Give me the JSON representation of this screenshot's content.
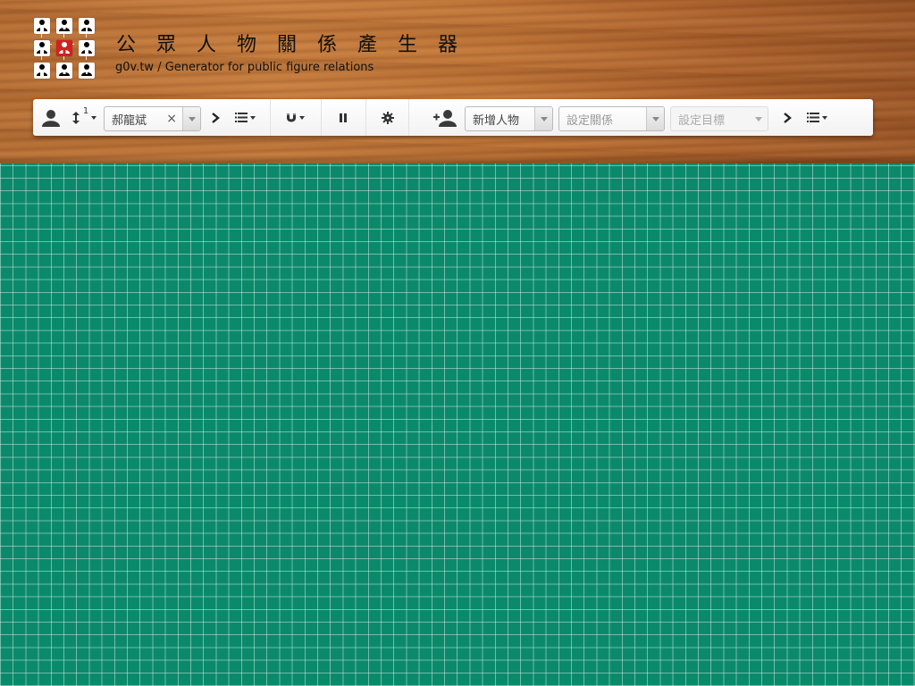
{
  "header": {
    "title": "公 眾 人 物 關 係 產 生 器",
    "subtitle": "g0v.tw / Generator for public figure relations",
    "logo": {
      "cells": [
        "person-icon",
        "person-icon",
        "person-icon",
        "person-icon",
        "person-icon-highlighted",
        "person-icon",
        "person-icon",
        "person-icon",
        "person-icon"
      ],
      "highlight_color": "#d42020"
    }
  },
  "toolbar": {
    "person_icon": "person-icon",
    "sort_icon": "vertical-arrows-icon",
    "sort_badge": "1",
    "person_select": {
      "value": "郝龍斌",
      "clear_label": "×"
    },
    "next_icon": "chevron-right-icon",
    "list_menu_icon": "list-icon",
    "magnet_icon": "magnet-icon",
    "pause_icon": "pause-icon",
    "gear_icon": "gear-icon",
    "add_person_icon": "add-person-icon",
    "add_person_select": {
      "value": "新增人物"
    },
    "relation_select": {
      "placeholder": "設定關係"
    },
    "target_select": {
      "placeholder": "設定目標"
    },
    "next2_icon": "chevron-right-icon",
    "list_menu2_icon": "list-icon"
  },
  "colors": {
    "wood": "#bd7235",
    "canvas_green": "#0b8a6b",
    "grid_line": "#ffffff",
    "accent_red": "#d42020"
  }
}
